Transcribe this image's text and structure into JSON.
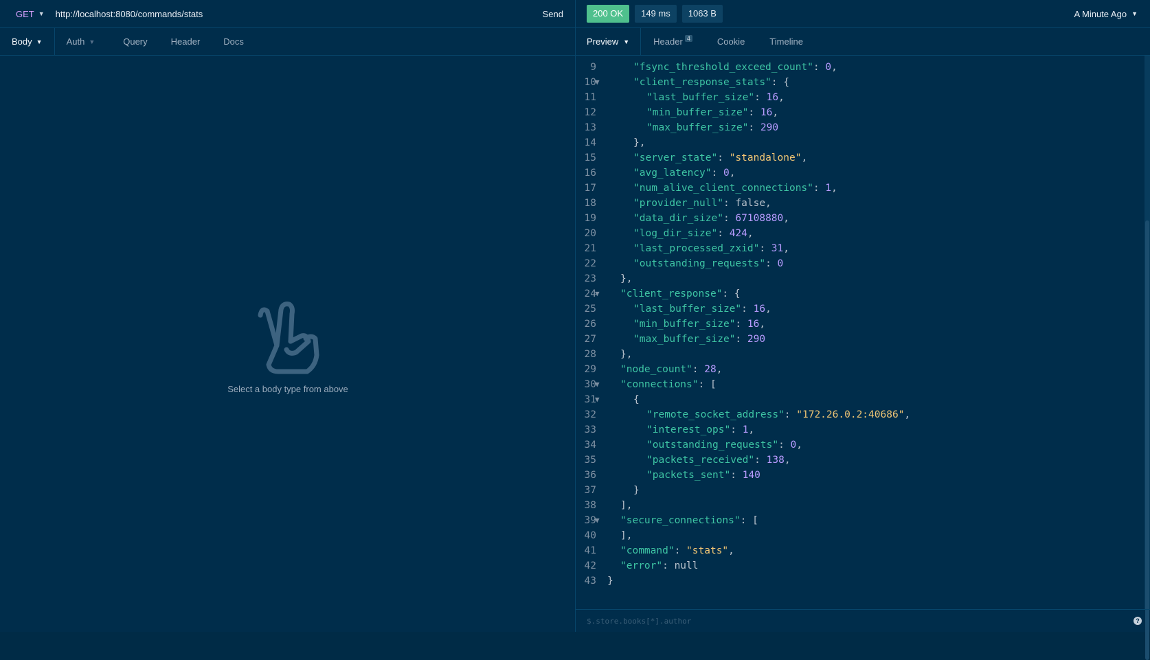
{
  "request": {
    "method": "GET",
    "url": "http://localhost:8080/commands/stats",
    "send_label": "Send",
    "tabs": [
      "Body",
      "Auth",
      "Query",
      "Header",
      "Docs"
    ],
    "empty_message": "Select a body type from above"
  },
  "response": {
    "status": "200 OK",
    "time": "149 ms",
    "size": "1063 B",
    "when": "A Minute Ago",
    "tabs": {
      "preview": "Preview",
      "header": "Header",
      "header_count": "4",
      "cookie": "Cookie",
      "timeline": "Timeline"
    },
    "filter_placeholder": "$.store.books[*].author",
    "lines": [
      {
        "n": "9",
        "fold": false,
        "indent": 2,
        "parts": [
          [
            "k",
            "\"fsync_threshold_exceed_count\""
          ],
          [
            "b",
            ": "
          ],
          [
            "n",
            "0"
          ],
          [
            "b",
            ","
          ]
        ]
      },
      {
        "n": "10",
        "fold": true,
        "indent": 2,
        "parts": [
          [
            "k",
            "\"client_response_stats\""
          ],
          [
            "b",
            ": {"
          ]
        ]
      },
      {
        "n": "11",
        "fold": false,
        "indent": 3,
        "parts": [
          [
            "k",
            "\"last_buffer_size\""
          ],
          [
            "b",
            ": "
          ],
          [
            "n",
            "16"
          ],
          [
            "b",
            ","
          ]
        ]
      },
      {
        "n": "12",
        "fold": false,
        "indent": 3,
        "parts": [
          [
            "k",
            "\"min_buffer_size\""
          ],
          [
            "b",
            ": "
          ],
          [
            "n",
            "16"
          ],
          [
            "b",
            ","
          ]
        ]
      },
      {
        "n": "13",
        "fold": false,
        "indent": 3,
        "parts": [
          [
            "k",
            "\"max_buffer_size\""
          ],
          [
            "b",
            ": "
          ],
          [
            "n",
            "290"
          ]
        ]
      },
      {
        "n": "14",
        "fold": false,
        "indent": 2,
        "parts": [
          [
            "b",
            "},"
          ]
        ]
      },
      {
        "n": "15",
        "fold": false,
        "indent": 2,
        "parts": [
          [
            "k",
            "\"server_state\""
          ],
          [
            "b",
            ": "
          ],
          [
            "s",
            "\"standalone\""
          ],
          [
            "b",
            ","
          ]
        ]
      },
      {
        "n": "16",
        "fold": false,
        "indent": 2,
        "parts": [
          [
            "k",
            "\"avg_latency\""
          ],
          [
            "b",
            ": "
          ],
          [
            "n",
            "0"
          ],
          [
            "b",
            ","
          ]
        ]
      },
      {
        "n": "17",
        "fold": false,
        "indent": 2,
        "parts": [
          [
            "k",
            "\"num_alive_client_connections\""
          ],
          [
            "b",
            ": "
          ],
          [
            "n",
            "1"
          ],
          [
            "b",
            ","
          ]
        ]
      },
      {
        "n": "18",
        "fold": false,
        "indent": 2,
        "parts": [
          [
            "k",
            "\"provider_null\""
          ],
          [
            "b",
            ": false,"
          ]
        ]
      },
      {
        "n": "19",
        "fold": false,
        "indent": 2,
        "parts": [
          [
            "k",
            "\"data_dir_size\""
          ],
          [
            "b",
            ": "
          ],
          [
            "n",
            "67108880"
          ],
          [
            "b",
            ","
          ]
        ]
      },
      {
        "n": "20",
        "fold": false,
        "indent": 2,
        "parts": [
          [
            "k",
            "\"log_dir_size\""
          ],
          [
            "b",
            ": "
          ],
          [
            "n",
            "424"
          ],
          [
            "b",
            ","
          ]
        ]
      },
      {
        "n": "21",
        "fold": false,
        "indent": 2,
        "parts": [
          [
            "k",
            "\"last_processed_zxid\""
          ],
          [
            "b",
            ": "
          ],
          [
            "n",
            "31"
          ],
          [
            "b",
            ","
          ]
        ]
      },
      {
        "n": "22",
        "fold": false,
        "indent": 2,
        "parts": [
          [
            "k",
            "\"outstanding_requests\""
          ],
          [
            "b",
            ": "
          ],
          [
            "n",
            "0"
          ]
        ]
      },
      {
        "n": "23",
        "fold": false,
        "indent": 1,
        "parts": [
          [
            "b",
            "},"
          ]
        ]
      },
      {
        "n": "24",
        "fold": true,
        "indent": 1,
        "parts": [
          [
            "k",
            "\"client_response\""
          ],
          [
            "b",
            ": {"
          ]
        ]
      },
      {
        "n": "25",
        "fold": false,
        "indent": 2,
        "parts": [
          [
            "k",
            "\"last_buffer_size\""
          ],
          [
            "b",
            ": "
          ],
          [
            "n",
            "16"
          ],
          [
            "b",
            ","
          ]
        ]
      },
      {
        "n": "26",
        "fold": false,
        "indent": 2,
        "parts": [
          [
            "k",
            "\"min_buffer_size\""
          ],
          [
            "b",
            ": "
          ],
          [
            "n",
            "16"
          ],
          [
            "b",
            ","
          ]
        ]
      },
      {
        "n": "27",
        "fold": false,
        "indent": 2,
        "parts": [
          [
            "k",
            "\"max_buffer_size\""
          ],
          [
            "b",
            ": "
          ],
          [
            "n",
            "290"
          ]
        ]
      },
      {
        "n": "28",
        "fold": false,
        "indent": 1,
        "parts": [
          [
            "b",
            "},"
          ]
        ]
      },
      {
        "n": "29",
        "fold": false,
        "indent": 1,
        "parts": [
          [
            "k",
            "\"node_count\""
          ],
          [
            "b",
            ": "
          ],
          [
            "n",
            "28"
          ],
          [
            "b",
            ","
          ]
        ]
      },
      {
        "n": "30",
        "fold": true,
        "indent": 1,
        "parts": [
          [
            "k",
            "\"connections\""
          ],
          [
            "b",
            ": ["
          ]
        ]
      },
      {
        "n": "31",
        "fold": true,
        "indent": 2,
        "parts": [
          [
            "b",
            "{"
          ]
        ]
      },
      {
        "n": "32",
        "fold": false,
        "indent": 3,
        "parts": [
          [
            "k",
            "\"remote_socket_address\""
          ],
          [
            "b",
            ": "
          ],
          [
            "s",
            "\"172.26.0.2:40686\""
          ],
          [
            "b",
            ","
          ]
        ]
      },
      {
        "n": "33",
        "fold": false,
        "indent": 3,
        "parts": [
          [
            "k",
            "\"interest_ops\""
          ],
          [
            "b",
            ": "
          ],
          [
            "n",
            "1"
          ],
          [
            "b",
            ","
          ]
        ]
      },
      {
        "n": "34",
        "fold": false,
        "indent": 3,
        "parts": [
          [
            "k",
            "\"outstanding_requests\""
          ],
          [
            "b",
            ": "
          ],
          [
            "n",
            "0"
          ],
          [
            "b",
            ","
          ]
        ]
      },
      {
        "n": "35",
        "fold": false,
        "indent": 3,
        "parts": [
          [
            "k",
            "\"packets_received\""
          ],
          [
            "b",
            ": "
          ],
          [
            "n",
            "138"
          ],
          [
            "b",
            ","
          ]
        ]
      },
      {
        "n": "36",
        "fold": false,
        "indent": 3,
        "parts": [
          [
            "k",
            "\"packets_sent\""
          ],
          [
            "b",
            ": "
          ],
          [
            "n",
            "140"
          ]
        ]
      },
      {
        "n": "37",
        "fold": false,
        "indent": 2,
        "parts": [
          [
            "b",
            "}"
          ]
        ]
      },
      {
        "n": "38",
        "fold": false,
        "indent": 1,
        "parts": [
          [
            "b",
            "],"
          ]
        ]
      },
      {
        "n": "39",
        "fold": true,
        "indent": 1,
        "parts": [
          [
            "k",
            "\"secure_connections\""
          ],
          [
            "b",
            ": ["
          ]
        ]
      },
      {
        "n": "40",
        "fold": false,
        "indent": 1,
        "parts": [
          [
            "b",
            "],"
          ]
        ]
      },
      {
        "n": "41",
        "fold": false,
        "indent": 1,
        "parts": [
          [
            "k",
            "\"command\""
          ],
          [
            "b",
            ": "
          ],
          [
            "s",
            "\"stats\""
          ],
          [
            "b",
            ","
          ]
        ]
      },
      {
        "n": "42",
        "fold": false,
        "indent": 1,
        "parts": [
          [
            "k",
            "\"error\""
          ],
          [
            "b",
            ": null"
          ]
        ]
      },
      {
        "n": "43",
        "fold": false,
        "indent": 0,
        "parts": [
          [
            "b",
            "}"
          ]
        ]
      }
    ]
  }
}
